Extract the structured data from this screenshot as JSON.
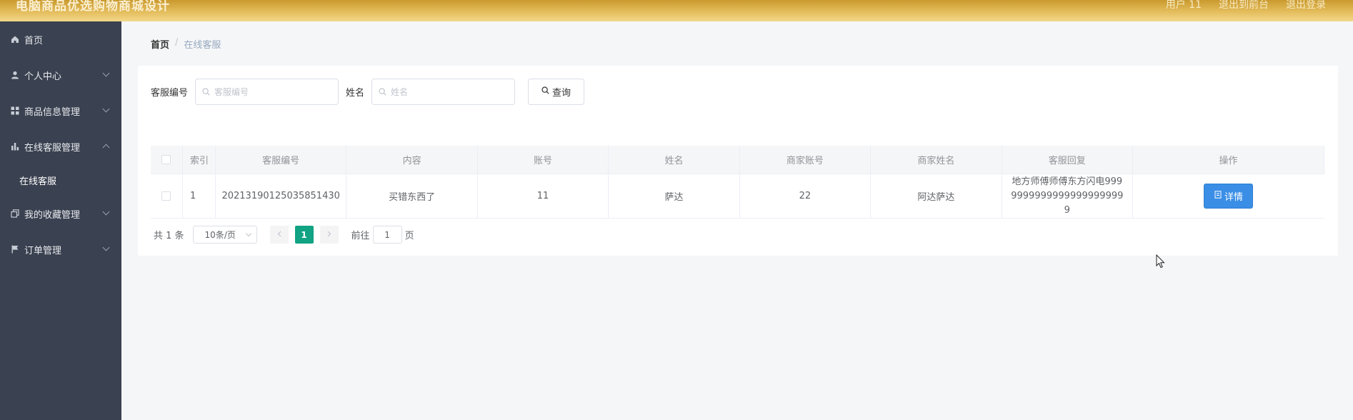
{
  "app": {
    "title": "电脑商品优选购物商城设计",
    "header_links": [
      "用户 11",
      "退出到前台",
      "退出登录"
    ]
  },
  "sidebar": {
    "items": [
      {
        "label": "首页",
        "icon": "home-icon",
        "expandable": false
      },
      {
        "label": "个人中心",
        "icon": "user-icon",
        "expandable": true
      },
      {
        "label": "商品信息管理",
        "icon": "grid-icon",
        "expandable": true
      },
      {
        "label": "在线客服管理",
        "icon": "bar-chart-icon",
        "expandable": true,
        "expanded": true
      },
      {
        "label": "我的收藏管理",
        "icon": "copy-icon",
        "expandable": true
      },
      {
        "label": "订单管理",
        "icon": "flag-icon",
        "expandable": true
      }
    ],
    "subitem": "在线客服"
  },
  "breadcrumb": {
    "home": "首页",
    "separator": "/",
    "current": "在线客服"
  },
  "search": {
    "field1_label": "客服编号",
    "field1_placeholder": "客服编号",
    "field2_label": "姓名",
    "field2_placeholder": "姓名",
    "query_button": "查询"
  },
  "table": {
    "headers": [
      "索引",
      "客服编号",
      "内容",
      "账号",
      "姓名",
      "商家账号",
      "商家姓名",
      "客服回复",
      "操作"
    ],
    "rows": [
      {
        "index": "1",
        "service_no": "20213190125035851430",
        "content": "买错东西了",
        "account": "11",
        "name": "萨达",
        "merchant_account": "22",
        "merchant_name": "阿达萨达",
        "reply": "地方师傅师傅东方闪电99999999999999999999999",
        "action": "详情"
      }
    ]
  },
  "pagination": {
    "total": "共 1 条",
    "page_size": "10条/页",
    "current_page": "1",
    "goto_prefix": "前往",
    "goto_value": "1",
    "goto_suffix": "页"
  },
  "colors": {
    "header_gold": "#e4bd5c",
    "sidebar_bg": "#3a4150",
    "primary": "#3a8ee6",
    "page_active": "#11a383"
  }
}
